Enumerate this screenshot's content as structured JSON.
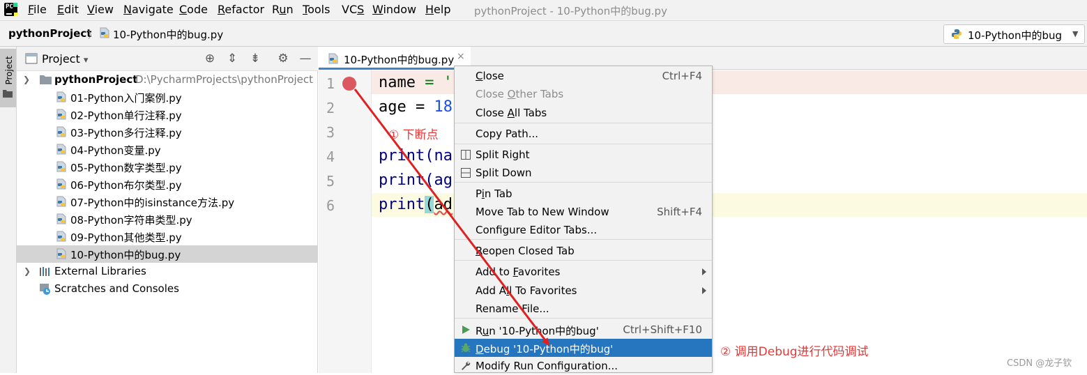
{
  "menubar": {
    "logo_text": "PC",
    "items": [
      {
        "pre": "",
        "mn": "F",
        "post": "ile"
      },
      {
        "pre": "",
        "mn": "E",
        "post": "dit"
      },
      {
        "pre": "",
        "mn": "V",
        "post": "iew"
      },
      {
        "pre": "",
        "mn": "N",
        "post": "avigate"
      },
      {
        "pre": "",
        "mn": "C",
        "post": "ode"
      },
      {
        "pre": "",
        "mn": "R",
        "post": "efactor"
      },
      {
        "pre": "R",
        "mn": "u",
        "post": "n"
      },
      {
        "pre": "",
        "mn": "T",
        "post": "ools"
      },
      {
        "pre": "VC",
        "mn": "S",
        "post": ""
      },
      {
        "pre": "",
        "mn": "W",
        "post": "indow"
      },
      {
        "pre": "",
        "mn": "H",
        "post": "elp"
      }
    ],
    "window_title": "pythonProject - 10-Python中的bug.py"
  },
  "navbar": {
    "project": "pythonProject",
    "separator": "〉",
    "file": "10-Python中的bug.py",
    "run_config": "10-Python中的bug",
    "run_config_arrow": "▼"
  },
  "tool_strip": {
    "project_label": "Project"
  },
  "project_panel": {
    "title": "Project",
    "title_arrow": "▾",
    "root": {
      "name": "pythonProject",
      "path": "D:\\PycharmProjects\\pythonProject"
    },
    "files": [
      "01-Python入门案例.py",
      "02-Python单行注释.py",
      "03-Python多行注释.py",
      "04-Python变量.py",
      "05-Python数字类型.py",
      "06-Python布尔类型.py",
      "07-Python中的isinstance方法.py",
      "08-Python字符串类型.py",
      "09-Python其他类型.py",
      "10-Python中的bug.py"
    ],
    "selected_index": 9,
    "external_libraries": "External Libraries",
    "scratches": "Scratches and Consoles"
  },
  "editor": {
    "tab_label": "10-Python中的bug.py",
    "tab_close": "×",
    "line_numbers": [
      "1",
      "2",
      "3",
      "4",
      "5",
      "6"
    ],
    "code": {
      "l1_name": "name",
      "l1_eq": " = '",
      "l2_name": "age",
      "l2_eq": " = ",
      "l2_num": "18",
      "l4": "print(na",
      "l5": "print(ag",
      "l6_a": "print",
      "l6_paren": "(",
      "l6_b": "ad"
    },
    "breakpoint_line": 1,
    "current_line": 6
  },
  "context_menu": {
    "items": [
      {
        "pre": "",
        "mn": "C",
        "post": "lose",
        "shortcut": "Ctrl+F4"
      },
      {
        "pre": "Close ",
        "mn": "O",
        "post": "ther Tabs",
        "shortcut": ""
      },
      {
        "pre": "Close ",
        "mn": "A",
        "post": "ll Tabs",
        "shortcut": ""
      },
      {
        "pre": "Copy Path...",
        "mn": "",
        "post": "",
        "shortcut": ""
      },
      {
        "pre": "Split Right",
        "mn": "",
        "post": "",
        "shortcut": ""
      },
      {
        "pre": "Split Down",
        "mn": "",
        "post": "",
        "shortcut": ""
      },
      {
        "pre": "P",
        "mn": "i",
        "post": "n Tab",
        "shortcut": ""
      },
      {
        "pre": "Move Tab to New Window",
        "mn": "",
        "post": "",
        "shortcut": "Shift+F4"
      },
      {
        "pre": "Configure Editor Tabs...",
        "mn": "",
        "post": "",
        "shortcut": ""
      },
      {
        "pre": "",
        "mn": "R",
        "post": "eopen Closed Tab",
        "shortcut": ""
      },
      {
        "pre": "Add to ",
        "mn": "F",
        "post": "avorites",
        "shortcut": ""
      },
      {
        "pre": "Add A",
        "mn": "l",
        "post": "l To Favorites",
        "shortcut": ""
      },
      {
        "pre": "Rename File...",
        "mn": "",
        "post": "",
        "shortcut": ""
      },
      {
        "pre": "R",
        "mn": "u",
        "post": "n '10-Python中的bug'",
        "shortcut": "Ctrl+Shift+F10"
      },
      {
        "pre": "",
        "mn": "D",
        "post": "ebug '10-Python中的bug'",
        "shortcut": ""
      },
      {
        "pre": "Modify Run Configuration...",
        "mn": "",
        "post": "",
        "shortcut": ""
      }
    ],
    "highlighted_index": 14
  },
  "annotations": {
    "step1": "① 下断点",
    "step2": "② 调用Debug进行代码调试",
    "color": "#e23a3a"
  },
  "watermark": "CSDN @龙子钦"
}
